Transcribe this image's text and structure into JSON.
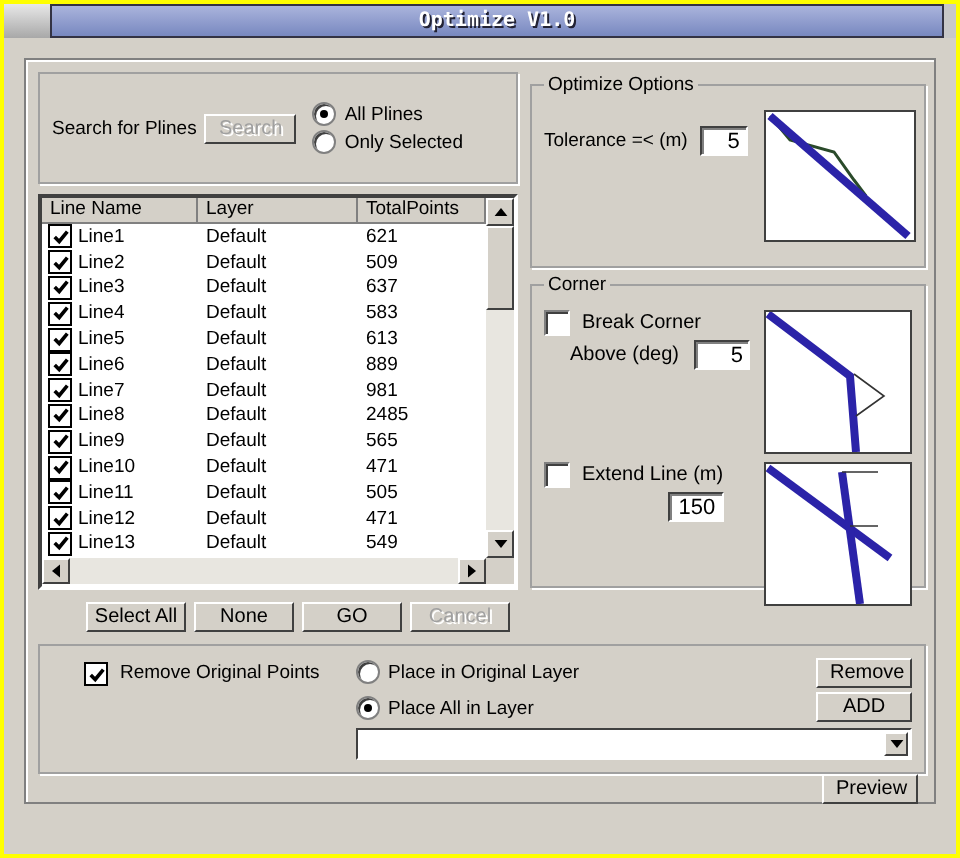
{
  "window": {
    "title": "Optimize V1.0"
  },
  "search": {
    "label": "Search for  Plines",
    "button": {
      "label": "Search",
      "disabled": true
    },
    "scope": [
      {
        "label": "All Plines",
        "selected": true
      },
      {
        "label": "Only Selected",
        "selected": false
      }
    ]
  },
  "table": {
    "columns": [
      "Line Name",
      "Layer",
      "TotalPoints"
    ],
    "rows": [
      {
        "name": "Line1",
        "layer": "Default",
        "points": "621",
        "checked": true
      },
      {
        "name": "Line2",
        "layer": "Default",
        "points": "509",
        "checked": true
      },
      {
        "name": "Line3",
        "layer": "Default",
        "points": "637",
        "checked": true
      },
      {
        "name": "Line4",
        "layer": "Default",
        "points": "583",
        "checked": true
      },
      {
        "name": "Line5",
        "layer": "Default",
        "points": "613",
        "checked": true
      },
      {
        "name": "Line6",
        "layer": "Default",
        "points": "889",
        "checked": true
      },
      {
        "name": "Line7",
        "layer": "Default",
        "points": "981",
        "checked": true
      },
      {
        "name": "Line8",
        "layer": "Default",
        "points": "2485",
        "checked": true
      },
      {
        "name": "Line9",
        "layer": "Default",
        "points": "565",
        "checked": true
      },
      {
        "name": "Line10",
        "layer": "Default",
        "points": "471",
        "checked": true
      },
      {
        "name": "Line11",
        "layer": "Default",
        "points": "505",
        "checked": true
      },
      {
        "name": "Line12",
        "layer": "Default",
        "points": "471",
        "checked": true
      },
      {
        "name": "Line13",
        "layer": "Default",
        "points": "549",
        "checked": true
      }
    ]
  },
  "list_buttons": [
    {
      "label": "Select All",
      "disabled": false
    },
    {
      "label": "None",
      "disabled": false
    },
    {
      "label": "GO",
      "disabled": false
    },
    {
      "label": "Cancel",
      "disabled": true
    }
  ],
  "optimize_options": {
    "title": "Optimize Options",
    "tolerance_label": "Tolerance =< (m)",
    "tolerance": "5"
  },
  "corner": {
    "title": "Corner",
    "break_label": "Break  Corner",
    "break_checked": false,
    "above_label": "Above (deg)",
    "above": "5",
    "extend_label": "Extend Line (m)",
    "extend_checked": false,
    "extend": "150"
  },
  "output": {
    "remove_original": {
      "label": "Remove Original Points",
      "checked": true
    },
    "placement": [
      {
        "label": "Place in Original Layer",
        "selected": false
      },
      {
        "label": "Place All in Layer",
        "selected": true
      }
    ],
    "remove_button": "Remove",
    "add_button": "ADD"
  },
  "preview_button": "Preview"
}
